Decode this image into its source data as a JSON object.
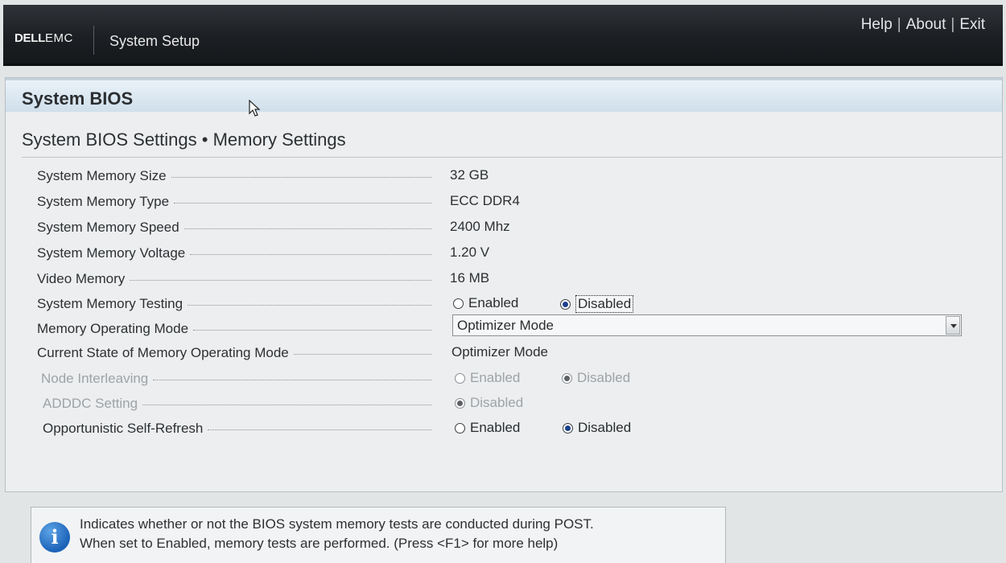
{
  "app": {
    "brand_bold": "DELL",
    "brand_light": "EMC",
    "title": "System Setup"
  },
  "nav": {
    "help": "Help",
    "about": "About",
    "exit": "Exit",
    "separator": "|"
  },
  "panel": {
    "title": "System BIOS",
    "subtitle": "System BIOS Settings • Memory Settings"
  },
  "settings": {
    "memory_size": {
      "label": "System Memory Size",
      "value": "32 GB"
    },
    "memory_type": {
      "label": "System Memory Type",
      "value": "ECC DDR4"
    },
    "memory_speed": {
      "label": "System Memory Speed",
      "value": "2400 Mhz"
    },
    "memory_voltage": {
      "label": "System Memory Voltage",
      "value": "1.20 V"
    },
    "video_memory": {
      "label": "Video Memory",
      "value": "16 MB"
    },
    "memory_testing": {
      "label": "System Memory Testing",
      "option_enabled": "Enabled",
      "option_disabled": "Disabled",
      "selected": "Disabled"
    },
    "operating_mode": {
      "label": "Memory Operating Mode",
      "selected": "Optimizer Mode"
    },
    "current_mode": {
      "label": "Current State of Memory Operating Mode",
      "value": "Optimizer Mode"
    },
    "node_interleaving": {
      "label": "Node Interleaving",
      "option_enabled": "Enabled",
      "option_disabled": "Disabled",
      "selected": "Disabled"
    },
    "adddc": {
      "label": "ADDDC Setting",
      "option_disabled": "Disabled",
      "selected": "Disabled"
    },
    "self_refresh": {
      "label": "Opportunistic Self-Refresh",
      "option_enabled": "Enabled",
      "option_disabled": "Disabled",
      "selected": "Disabled"
    }
  },
  "help": {
    "icon": "info-icon",
    "icon_glyph": "i",
    "text": "Indicates whether or not the BIOS system memory tests are conducted during POST.\nWhen set to Enabled, memory tests are performed. (Press <F1> for more help)"
  },
  "colors": {
    "topbar": "#1c1f23",
    "header_band": "#cfdfeb",
    "radio_selected": "#1b3f8a",
    "info_blue": "#1b62b8"
  }
}
